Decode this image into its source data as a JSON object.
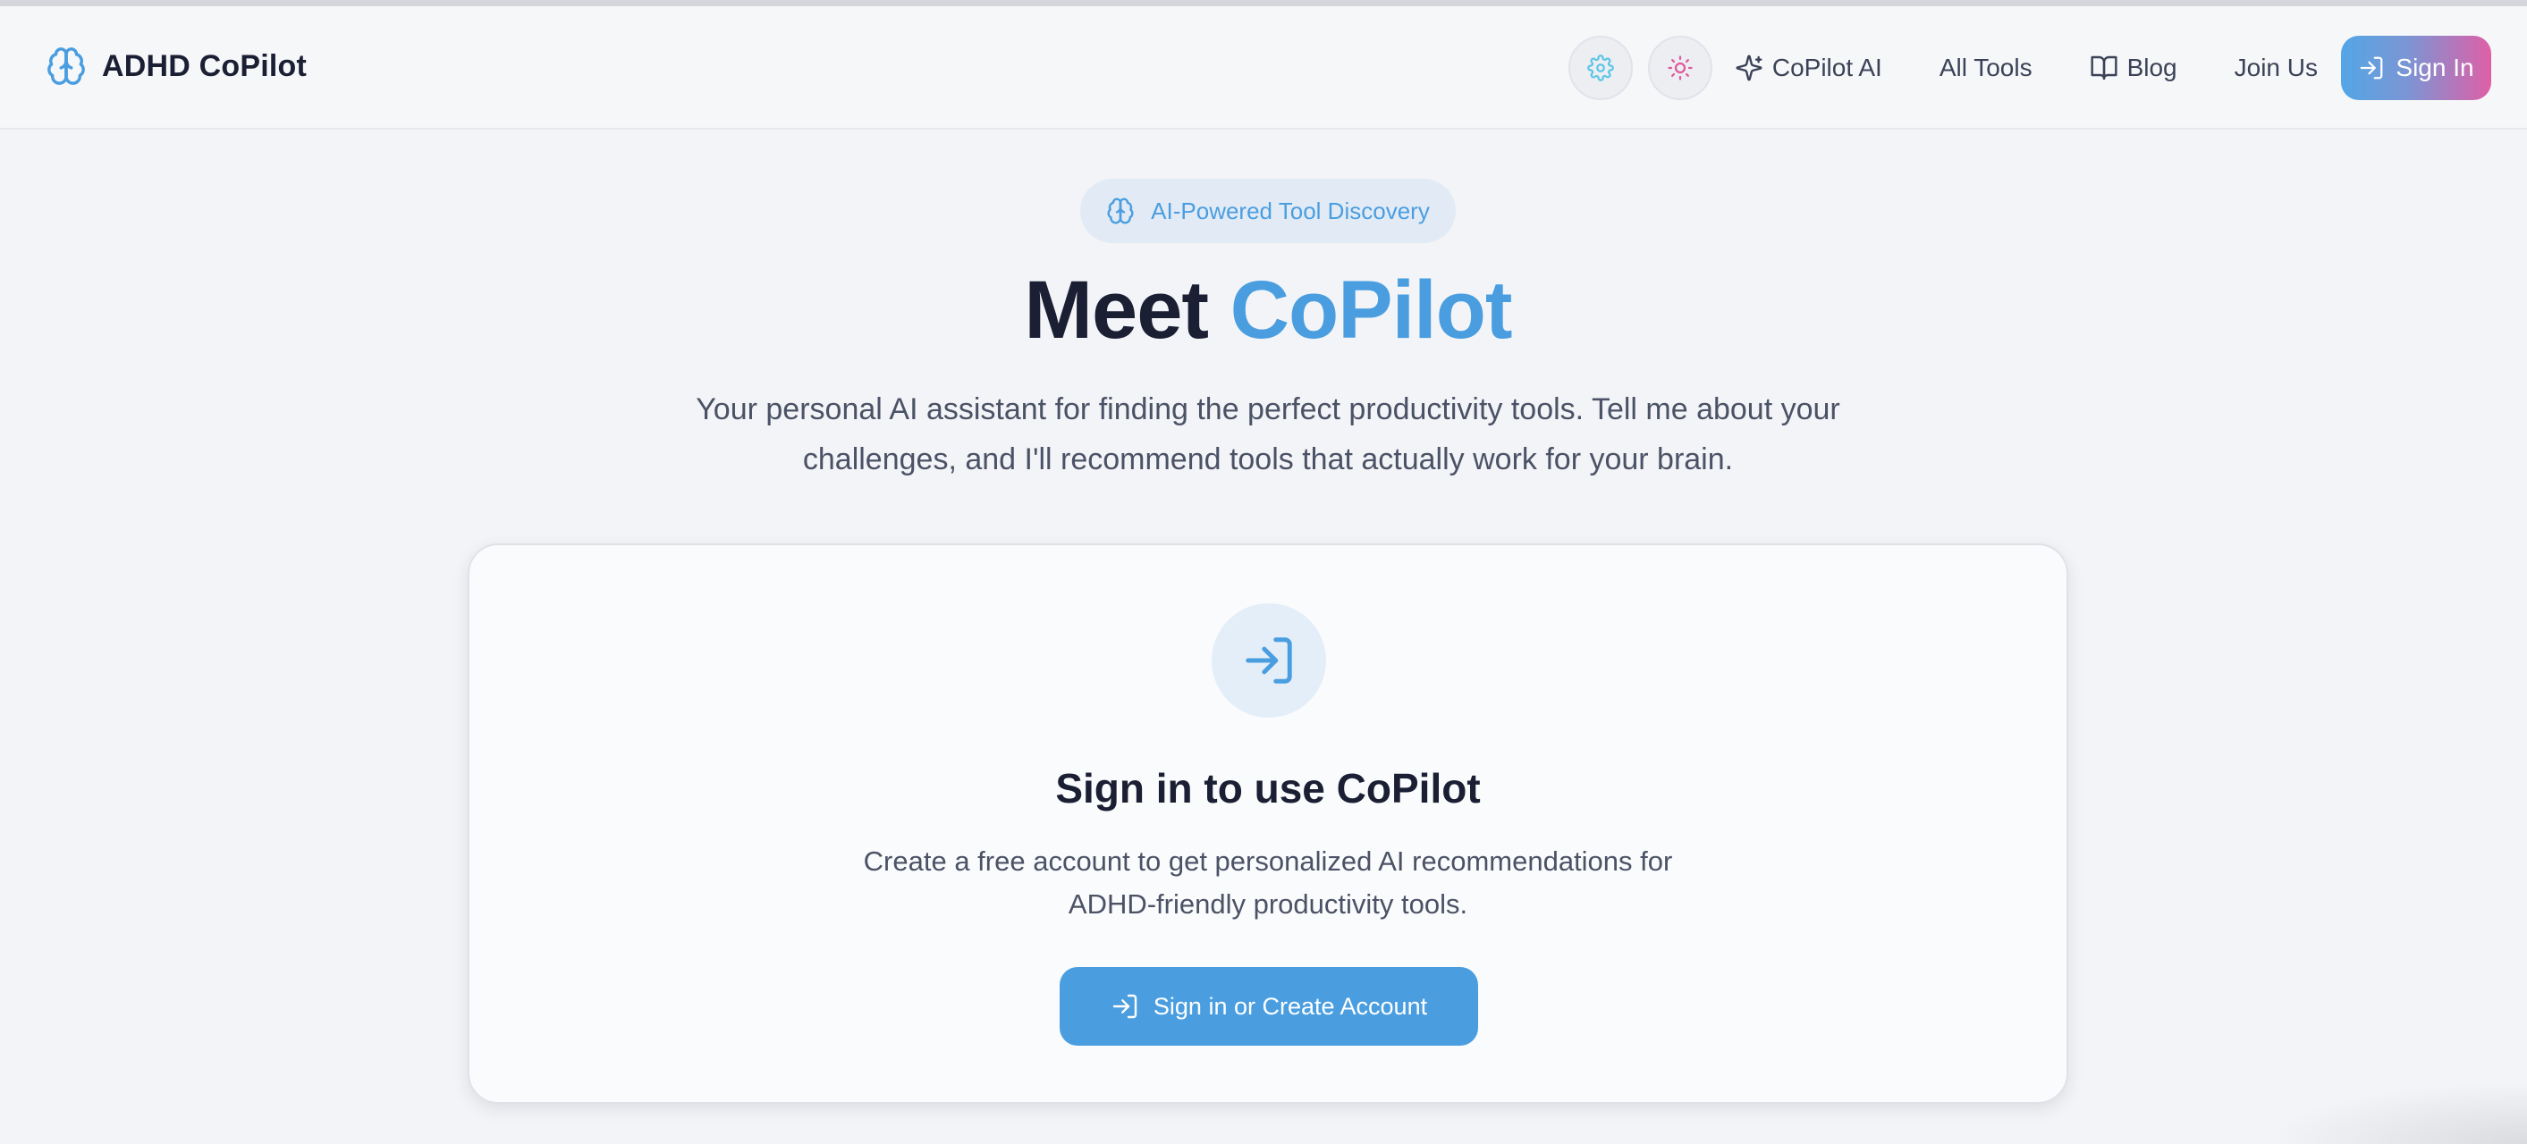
{
  "brand": {
    "name": "ADHD CoPilot",
    "icon": "brain-icon"
  },
  "nav": {
    "settings_icon": "gear-icon",
    "theme_icon": "sun-icon",
    "links": [
      {
        "label": "CoPilot AI",
        "icon": "sparkles-icon"
      },
      {
        "label": "All Tools"
      },
      {
        "label": "Blog",
        "icon": "book-icon"
      },
      {
        "label": "Join Us"
      }
    ],
    "signin_label": "Sign In",
    "signin_icon": "login-icon"
  },
  "hero": {
    "badge": "AI-Powered Tool Discovery",
    "title_prefix": "Meet",
    "title_accent": "CoPilot",
    "subtitle_line1": "Your personal AI assistant for finding the perfect productivity tools. Tell me about your",
    "subtitle_line2": "challenges, and I'll recommend tools that actually work for your brain."
  },
  "card": {
    "icon": "login-icon",
    "title": "Sign in to use CoPilot",
    "desc_line1": "Create a free account to get personalized AI recommendations for",
    "desc_line2": "ADHD-friendly productivity tools.",
    "button_label": "Sign in or Create Account"
  },
  "colors": {
    "accent": "#4a9ee0",
    "text_dark": "#1a1f33",
    "gradient_end": "#df5fa6",
    "theme_icon": "#e0589d",
    "settings_icon": "#5ec6e6"
  }
}
